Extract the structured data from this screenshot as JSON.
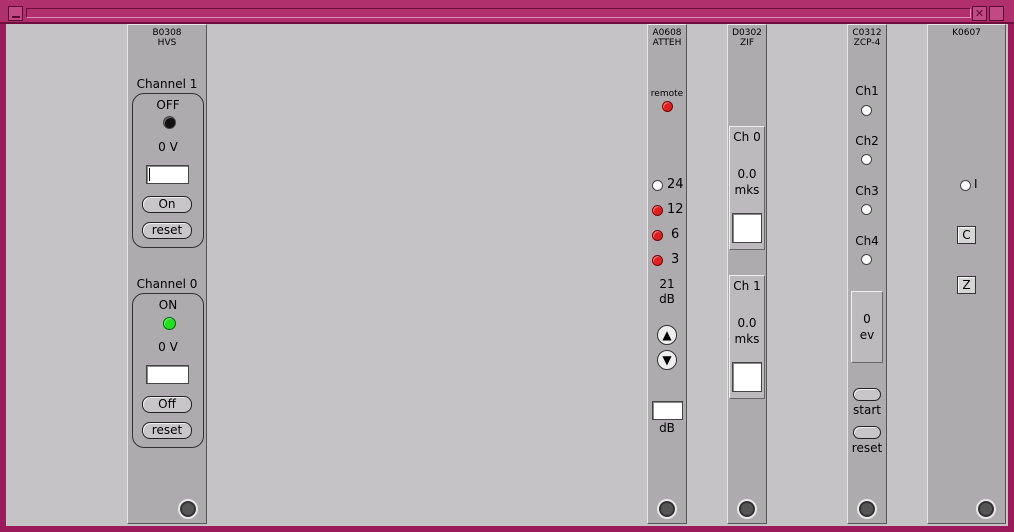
{
  "titlebar": {
    "min_icon": "minimize-icon",
    "close_icon": "close-icon"
  },
  "hvs": {
    "header_line1": "B0308",
    "header_line2": "HVS",
    "channels": [
      {
        "title": "Channel 1",
        "state": "OFF",
        "voltage": "0 V",
        "input_value": "",
        "toggle_label": "On",
        "reset_label": "reset",
        "led": "black"
      },
      {
        "title": "Channel 0",
        "state": "ON",
        "voltage": "0 V",
        "input_value": "",
        "toggle_label": "Off",
        "reset_label": "reset",
        "led": "green"
      }
    ]
  },
  "atten": {
    "header_line1": "A0608",
    "header_line2": "ATTEH",
    "remote_label": "remote",
    "steps": [
      {
        "value": "24",
        "led": "off"
      },
      {
        "value": "12",
        "led": "red"
      },
      {
        "value": "6",
        "led": "red"
      },
      {
        "value": "3",
        "led": "red"
      }
    ],
    "total_value": "21",
    "total_unit": "dB",
    "input_unit": "dB",
    "input_value": ""
  },
  "zif": {
    "header_line1": "D0302",
    "header_line2": "ZIF",
    "channels": [
      {
        "label": "Ch 0",
        "value": "0.0",
        "unit": "mks"
      },
      {
        "label": "Ch 1",
        "value": "0.0",
        "unit": "mks"
      }
    ]
  },
  "zcp": {
    "header_line1": "C0312",
    "header_line2": "ZCP-4",
    "channels": [
      "Ch1",
      "Ch2",
      "Ch3",
      "Ch4"
    ],
    "count_value": "0",
    "count_unit": "ev",
    "start_label": "start",
    "reset_label": "reset"
  },
  "k0607": {
    "header_line1": "K0607",
    "indicator_label": "I",
    "c_label": "C",
    "z_label": "Z"
  }
}
